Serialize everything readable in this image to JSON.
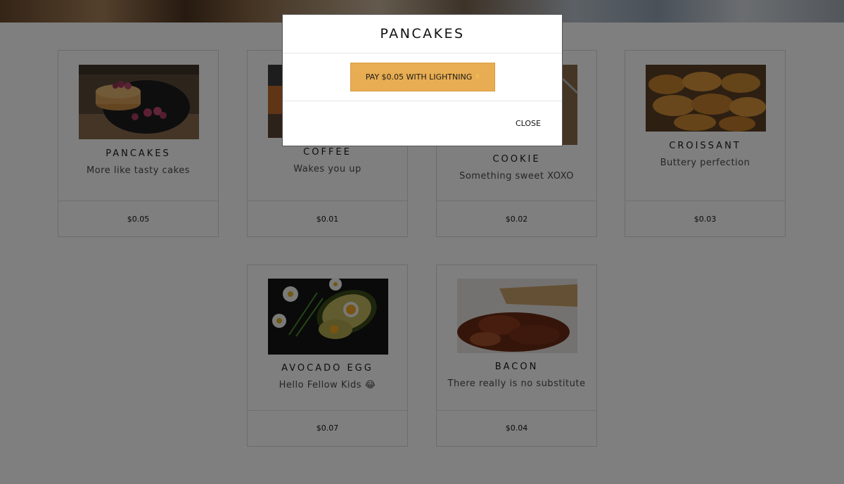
{
  "modal": {
    "title": "PANCAKES",
    "pay_label": "PAY $0.05 WITH LIGHTNING",
    "pay_icon": "lightning-icon",
    "close_label": "CLOSE"
  },
  "products": [
    {
      "name": "PANCAKES",
      "description": "More like tasty cakes",
      "price": "$0.05",
      "image": "pancakes-image"
    },
    {
      "name": "COFFEE",
      "description": "Wakes you up",
      "price": "$0.01",
      "image": "coffee-image"
    },
    {
      "name": "COOKIE",
      "description": "Something sweet XOXO",
      "price": "$0.02",
      "image": "cookie-image"
    },
    {
      "name": "CROISSANT",
      "description": "Buttery perfection",
      "price": "$0.03",
      "image": "croissant-image"
    },
    {
      "name": "AVOCADO EGG",
      "description": "Hello Fellow Kids 😂",
      "price": "$0.07",
      "image": "avocado-egg-image"
    },
    {
      "name": "BACON",
      "description": "There really is no substitute",
      "price": "$0.04",
      "image": "bacon-image"
    }
  ],
  "colors": {
    "overlay": "#000000",
    "pay_button": "#e8ad52",
    "card_border": "#d9d9d9"
  }
}
